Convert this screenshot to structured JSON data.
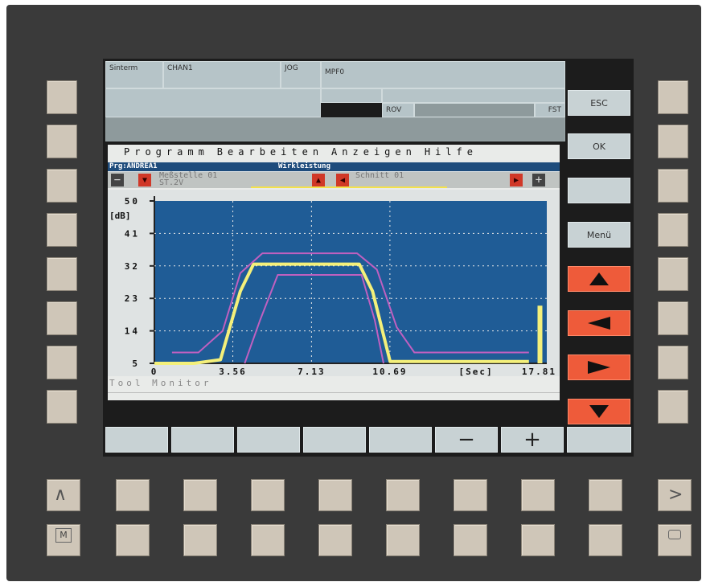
{
  "header": {
    "app": "Sinterm",
    "channel": "CHAN1",
    "mode": "JOG",
    "program": "MPF0",
    "rov": "ROV",
    "fst": "FST"
  },
  "softkeys_right": {
    "esc": "ESC",
    "ok": "OK",
    "menu": "Menü"
  },
  "softkeys_bottom": {
    "minus": "−",
    "plus": "+"
  },
  "window": {
    "menu": [
      "Programm",
      "Bearbeiten",
      "Anzeigen",
      "Hilfe"
    ],
    "program_label": "Prg:ANDREA1",
    "plot_title": "Wirkleistung",
    "measure_point": "Meßstelle 01",
    "sensor": "ST.2V",
    "cut": "Schnitt 01",
    "status": "Tool Monitor"
  },
  "chart_data": {
    "type": "line",
    "title": "Wirkleistung",
    "ylabel": "[dB]",
    "xlabel": "[Sec]",
    "xlim": [
      0,
      17.81
    ],
    "ylim": [
      5,
      50
    ],
    "x_ticks": [
      "0",
      "3.56",
      "7.13",
      "10.69",
      "[Sec]",
      "17.81"
    ],
    "y_ticks": [
      "50",
      "41",
      "32",
      "23",
      "14",
      "5"
    ],
    "grid": true,
    "colors": {
      "signal": "#f4f07a",
      "envelope": "#c060c0",
      "background": "#1f5c96"
    },
    "series": [
      {
        "role": "signal",
        "x": [
          0,
          1.8,
          3.0,
          3.9,
          4.5,
          9.3,
          9.9,
          10.7,
          17.0
        ],
        "y": [
          5,
          5,
          6,
          25,
          32.5,
          32.5,
          25,
          5.5,
          5.5
        ]
      },
      {
        "role": "upper-envelope",
        "x": [
          0.8,
          2.0,
          3.1,
          3.9,
          4.9,
          9.2,
          10.1,
          11.0,
          11.8,
          17.0
        ],
        "y": [
          8,
          8,
          14,
          30,
          35.5,
          35.5,
          31,
          15,
          8,
          8
        ]
      },
      {
        "role": "lower-envelope",
        "x": [
          4.1,
          4.8,
          5.6,
          9.4,
          10.0,
          10.4
        ],
        "y": [
          5,
          17,
          29.5,
          29.5,
          17,
          5
        ]
      },
      {
        "role": "level-bar",
        "x": [
          17.5,
          17.5
        ],
        "y": [
          5,
          21
        ]
      }
    ]
  }
}
